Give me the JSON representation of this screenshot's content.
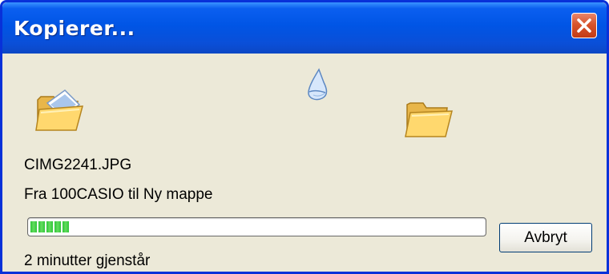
{
  "window": {
    "title": "Kopierer..."
  },
  "icons": {
    "source": "open-folder-with-file-icon",
    "flying_document": "flying-document-icon",
    "destination": "open-folder-icon",
    "close": "close-icon"
  },
  "operation": {
    "file_name": "CIMG2241.JPG",
    "from_to": "Fra 100CASIO til Ny mappe",
    "progress_percent": 8,
    "time_remaining": "2 minutter gjenstår"
  },
  "buttons": {
    "cancel_label": "Avbryt"
  },
  "colors": {
    "titlebar": "#0055e5",
    "dialog_background": "#ece9d8",
    "progress_green": "#2fc63a",
    "close_red": "#d8542c"
  }
}
